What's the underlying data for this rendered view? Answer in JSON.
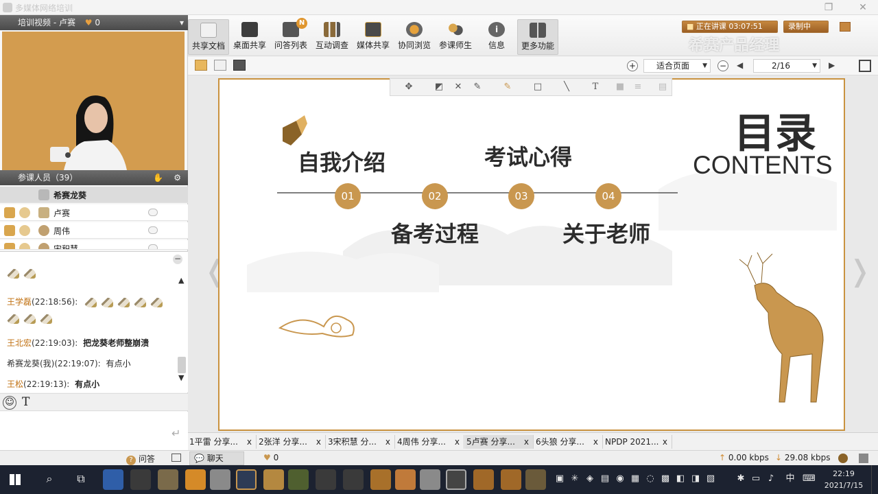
{
  "window": {
    "title": "多媒体网络培训"
  },
  "left_panel": {
    "video_title": "培训视频 - 卢赛",
    "video_flower_count": "0",
    "participants_title": "参课人员（39）",
    "participants": [
      {
        "name": "希赛龙葵"
      },
      {
        "name": "卢赛"
      },
      {
        "name": "周伟"
      },
      {
        "name": "宋积慧"
      }
    ]
  },
  "chat": {
    "messages": [
      {
        "who": "王学磊",
        "time": "(22:18:56):",
        "text": ""
      },
      {
        "who": "王北宏",
        "time": "(22:19:03):",
        "text": "把龙葵老师整崩溃"
      },
      {
        "who": "希赛龙葵(我)",
        "time": "(22:19:07):",
        "text": "有点小"
      },
      {
        "who": "王松",
        "time": "(22:19:13):",
        "text": "有点小"
      }
    ],
    "input_value": ""
  },
  "toolbar": {
    "items": [
      {
        "label": "共享文档"
      },
      {
        "label": "桌面共享"
      },
      {
        "label": "问答列表"
      },
      {
        "label": "互动调查"
      },
      {
        "label": "媒体共享"
      },
      {
        "label": "协同浏览"
      },
      {
        "label": "参课师生"
      },
      {
        "label": "信息"
      },
      {
        "label": "更多功能"
      }
    ],
    "badge": "N",
    "live_status": "正在讲课 03:07:51",
    "record_status": "录制中",
    "watermark": "希赛产品经理"
  },
  "doc_toolbar": {
    "zoom_option": "适合页面",
    "page_indicator": "2/16"
  },
  "slide": {
    "title_cn": "目录",
    "title_en": "CONTENTS",
    "items": [
      {
        "number": "01",
        "label": "自我介绍"
      },
      {
        "number": "02",
        "label": "备考过程"
      },
      {
        "number": "03",
        "label": "考试心得"
      },
      {
        "number": "04",
        "label": "关于老师"
      }
    ]
  },
  "tabs": [
    {
      "label": "1平雷 分享..."
    },
    {
      "label": "2张洋 分享..."
    },
    {
      "label": "3宋积慧 分..."
    },
    {
      "label": "4周伟 分享..."
    },
    {
      "label": "5卢赛 分享..."
    },
    {
      "label": "6头狼 分享..."
    },
    {
      "label": "NPDP 2021..."
    }
  ],
  "statusbar": {
    "qa_label": "问答",
    "chat_label": "聊天",
    "flower_count": "0",
    "upload": "0.00 kbps",
    "download": "29.08 kbps"
  },
  "taskbar": {
    "time": "22:19",
    "date": "2021/7/15",
    "ime": "中"
  }
}
